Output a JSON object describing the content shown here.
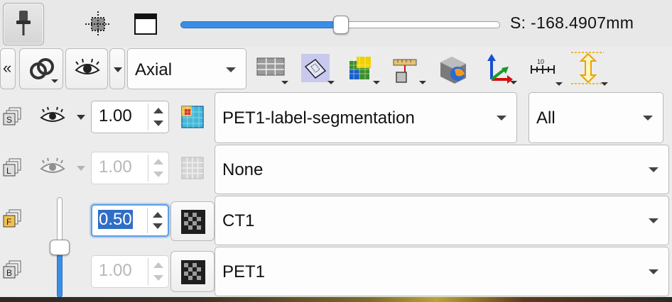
{
  "toolbar_top": {
    "slider_value_label": "S: -168.4907mm",
    "slider_position": 0.5
  },
  "view_toolbar": {
    "expand_label": "«",
    "orientation_combo": "Axial"
  },
  "layers": [
    {
      "id": "segmentation",
      "letter": "S",
      "opacity": "1.00",
      "volume": "PET1-label-segmentation",
      "segment_filter": "All"
    },
    {
      "id": "label",
      "letter": "L",
      "opacity": "1.00",
      "volume": "None"
    },
    {
      "id": "foreground",
      "letter": "F",
      "opacity": "0.50",
      "volume": "CT1"
    },
    {
      "id": "background",
      "letter": "B",
      "opacity": "1.00",
      "volume": "PET1"
    }
  ],
  "fg_bg_slider_position": 0.5,
  "colors": {
    "accent": "#3b8ee5",
    "selection": "#2f6ec7",
    "foreground_badge": "#f2c14e"
  }
}
